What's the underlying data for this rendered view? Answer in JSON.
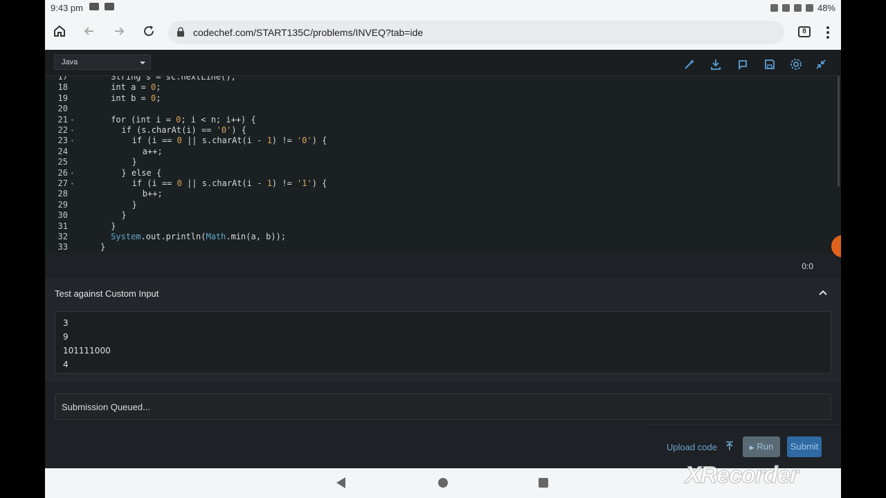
{
  "status_bar": {
    "time": "9:43 pm",
    "battery": "48%"
  },
  "browser": {
    "url": "codechef.com/START135C/problems/INVEQ?tab=ide",
    "tab_count": "8"
  },
  "editor": {
    "language": "Java",
    "lines": [
      {
        "n": "17",
        "html": "<span class=\"cls\"></span>String s = sc.nextLine();",
        "indent": 6
      },
      {
        "n": "18",
        "code": "int a = 0;",
        "indent": 6
      },
      {
        "n": "19",
        "code": "int b = 0;",
        "indent": 6
      },
      {
        "n": "20",
        "code": "",
        "indent": 6
      },
      {
        "n": "21",
        "code": "for (int i = 0; i < n; i++) {",
        "indent": 6,
        "fold": true
      },
      {
        "n": "22",
        "code": "if (s.charAt(i) == '0') {",
        "indent": 8,
        "fold": true
      },
      {
        "n": "23",
        "code": "if (i == 0 || s.charAt(i - 1) != '0') {",
        "indent": 10,
        "fold": true
      },
      {
        "n": "24",
        "code": "a++;",
        "indent": 12
      },
      {
        "n": "25",
        "code": "}",
        "indent": 10
      },
      {
        "n": "26",
        "code": "} else {",
        "indent": 8,
        "fold": true
      },
      {
        "n": "27",
        "code": "if (i == 0 || s.charAt(i - 1) != '1') {",
        "indent": 10,
        "fold": true
      },
      {
        "n": "28",
        "code": "b++;",
        "indent": 12
      },
      {
        "n": "29",
        "code": "}",
        "indent": 10
      },
      {
        "n": "30",
        "code": "}",
        "indent": 8
      },
      {
        "n": "31",
        "code": "}",
        "indent": 6
      },
      {
        "n": "32",
        "code": "System.out.println(Math.min(a, b));",
        "indent": 6
      },
      {
        "n": "33",
        "code": "}",
        "indent": 4
      }
    ],
    "cursor": "0:0"
  },
  "custom_input": {
    "title": "Test against Custom Input",
    "lines": [
      "3",
      "9",
      "101111000",
      "4"
    ]
  },
  "status_message": "Submission Queued...",
  "actions": {
    "upload_label": "Upload code",
    "run_label": "Run",
    "submit_label": "Submit"
  },
  "watermark": "XRecorder"
}
